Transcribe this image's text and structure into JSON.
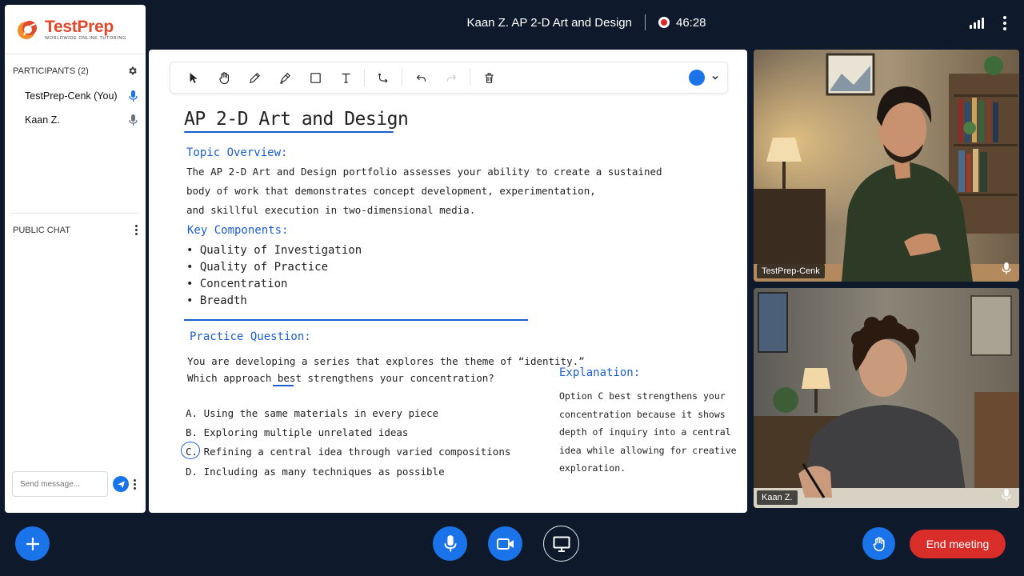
{
  "header": {
    "meeting_title": "Kaan Z. AP 2-D Art and Design",
    "timer": "46:28"
  },
  "brand": {
    "name": "TestPrep",
    "tagline": "WORLDWIDE ONLINE TUTORING"
  },
  "participants": {
    "heading": "PARTICIPANTS (2)",
    "list": [
      {
        "name": "TestPrep-Cenk (You)",
        "mic_active": true
      },
      {
        "name": "Kaan Z.",
        "mic_active": false
      }
    ]
  },
  "chat": {
    "heading": "PUBLIC CHAT",
    "input_placeholder": "Send message..."
  },
  "whiteboard": {
    "title": "AP  2-D  Art  and  Design",
    "topic_heading": "Topic  Overview:",
    "overview_lines": [
      "The  AP  2-D  Art  and  Design  portfolio  assesses  your  ability  to  create  a  sustained",
      "body  of  work  that  demonstrates  concept  development,  experimentation,",
      "and  skillful  execution  in  two-dimensional  media."
    ],
    "components_heading": "Key  Components:",
    "components": [
      "• Quality  of  Investigation",
      "• Quality  of  Practice",
      "• Concentration",
      "• Breadth"
    ],
    "question_heading": "Practice  Question:",
    "question_lines": [
      "You  are  developing  a  series  that  explores  the  theme  of  “identity.”",
      "Which  approach  best  strengthens  your  concentration?"
    ],
    "options": [
      "A.  Using  the  same  materials  in  every  piece",
      "B.  Exploring  multiple  unrelated  ideas",
      "C.  Refining  a  central  idea  through  varied  compositions",
      "D.  Including  as  many  techniques  as  possible"
    ],
    "selected_option": "C",
    "explanation_heading": "Explanation:",
    "explanation_lines": [
      "Option  C  best  strengthens  your",
      "concentration  because  it  shows",
      "depth  of  inquiry  into  a  central",
      "idea  while  allowing  for  creative",
      "exploration."
    ],
    "pen_color": "#1a73e8"
  },
  "videos": [
    {
      "name": "TestPrep-Cenk"
    },
    {
      "name": "Kaan Z."
    }
  ],
  "controls": {
    "end_label": "End meeting"
  },
  "colors": {
    "accent": "#1a73e8",
    "danger": "#d92d2a",
    "background": "#0e1a2b",
    "ink_blue": "#1c5fd1"
  }
}
